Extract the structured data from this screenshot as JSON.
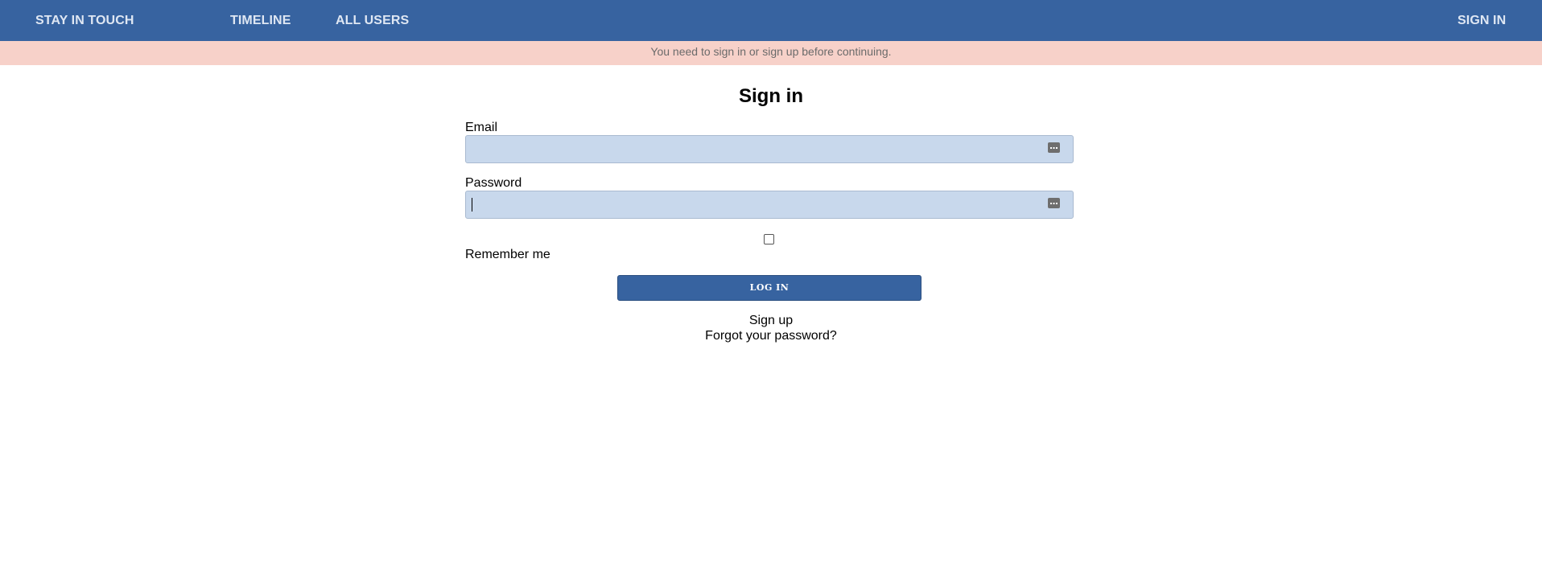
{
  "navbar": {
    "brand": "STAY IN TOUCH",
    "links": [
      {
        "label": "TIMELINE"
      },
      {
        "label": "ALL USERS"
      }
    ],
    "sign_in": "SIGN IN",
    "background_color": "#3763a0"
  },
  "alert": {
    "message": "You need to sign in or sign up before continuing.",
    "background_color": "#f7d1c9"
  },
  "form": {
    "title": "Sign in",
    "email": {
      "label": "Email",
      "value": "",
      "icon": "autofill-key-icon"
    },
    "password": {
      "label": "Password",
      "value": "",
      "icon": "autofill-key-icon"
    },
    "remember_me": {
      "label": "Remember me",
      "checked": false
    },
    "submit_label": "LOG IN",
    "input_background": "#c8d8ec"
  },
  "links": {
    "sign_up": "Sign up",
    "forgot_password": "Forgot your password?"
  }
}
